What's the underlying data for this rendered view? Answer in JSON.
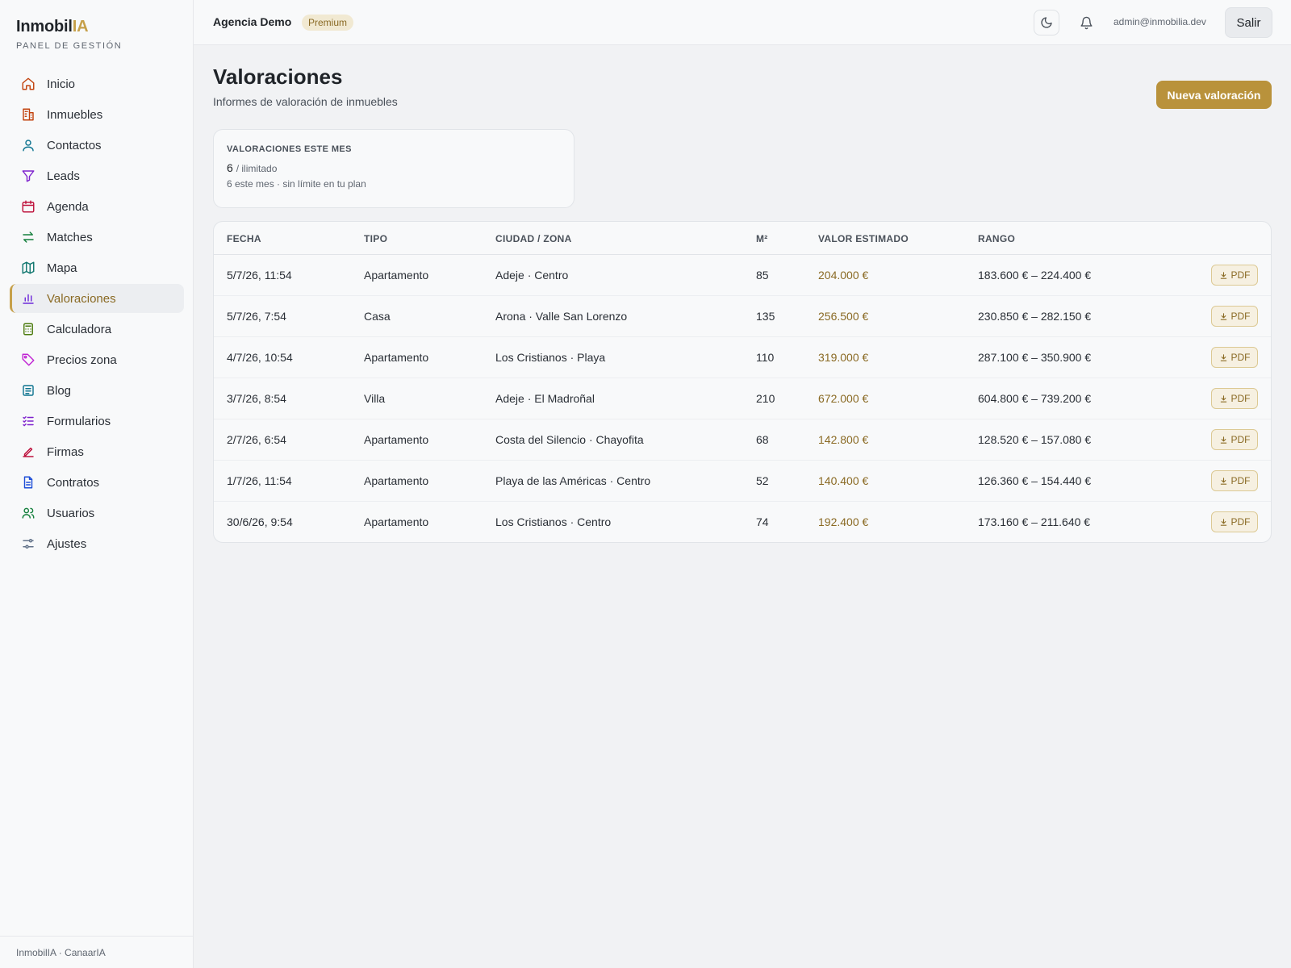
{
  "brand": {
    "name_main": "Inmobil",
    "name_accent": "IA",
    "subtitle": "PANEL DE GESTIÓN"
  },
  "sidebar": {
    "items": [
      {
        "label": "Inicio",
        "icon": "home-icon",
        "color": "#c2410c"
      },
      {
        "label": "Inmuebles",
        "icon": "building-icon",
        "color": "#c2410c"
      },
      {
        "label": "Contactos",
        "icon": "user-icon",
        "color": "#0e7490"
      },
      {
        "label": "Leads",
        "icon": "filter-icon",
        "color": "#7e22ce"
      },
      {
        "label": "Agenda",
        "icon": "calendar-icon",
        "color": "#be123c"
      },
      {
        "label": "Matches",
        "icon": "arrows-icon",
        "color": "#15803d"
      },
      {
        "label": "Mapa",
        "icon": "map-icon",
        "color": "#0f766e"
      },
      {
        "label": "Valoraciones",
        "icon": "bar-chart-icon",
        "color": "#6d28d9",
        "active": true
      },
      {
        "label": "Calculadora",
        "icon": "calculator-icon",
        "color": "#4d7c0f"
      },
      {
        "label": "Precios zona",
        "icon": "tag-icon",
        "color": "#c026d3"
      },
      {
        "label": "Blog",
        "icon": "newspaper-icon",
        "color": "#0e7490"
      },
      {
        "label": "Formularios",
        "icon": "list-check-icon",
        "color": "#7e22ce"
      },
      {
        "label": "Firmas",
        "icon": "signature-icon",
        "color": "#be123c"
      },
      {
        "label": "Contratos",
        "icon": "document-icon",
        "color": "#1d4ed8"
      },
      {
        "label": "Usuarios",
        "icon": "users-icon",
        "color": "#15803d"
      },
      {
        "label": "Ajustes",
        "icon": "sliders-icon",
        "color": "#64748b"
      }
    ],
    "footer": "InmobilIA · CanaarIA"
  },
  "topbar": {
    "agency": "Agencia Demo",
    "plan_badge": "Premium",
    "theme_icon": "moon-icon",
    "notifications_icon": "bell-icon",
    "user_email": "admin@inmobilia.dev",
    "logout_label": "Salir"
  },
  "page": {
    "title": "Valoraciones",
    "subtitle": "Informes de valoración de inmuebles",
    "new_button": "Nueva valoración"
  },
  "stat": {
    "label": "VALORACIONES ESTE MES",
    "value": "6",
    "limit": "/ ilimitado",
    "note": "6 este mes · sin límite en tu plan"
  },
  "table": {
    "headers": [
      "FECHA",
      "TIPO",
      "CIUDAD / ZONA",
      "M²",
      "VALOR ESTIMADO",
      "RANGO"
    ],
    "pdf_label": "PDF",
    "rows": [
      {
        "fecha": "5/7/26, 11:54",
        "tipo": "Apartamento",
        "zona": "Adeje · Centro",
        "m2": "85",
        "valor": "204.000 €",
        "rango": "183.600 € – 224.400 €"
      },
      {
        "fecha": "5/7/26, 7:54",
        "tipo": "Casa",
        "zona": "Arona · Valle San Lorenzo",
        "m2": "135",
        "valor": "256.500 €",
        "rango": "230.850 € – 282.150 €"
      },
      {
        "fecha": "4/7/26, 10:54",
        "tipo": "Apartamento",
        "zona": "Los Cristianos · Playa",
        "m2": "110",
        "valor": "319.000 €",
        "rango": "287.100 € – 350.900 €"
      },
      {
        "fecha": "3/7/26, 8:54",
        "tipo": "Villa",
        "zona": "Adeje · El Madroñal",
        "m2": "210",
        "valor": "672.000 €",
        "rango": "604.800 € – 739.200 €"
      },
      {
        "fecha": "2/7/26, 6:54",
        "tipo": "Apartamento",
        "zona": "Costa del Silencio · Chayofita",
        "m2": "68",
        "valor": "142.800 €",
        "rango": "128.520 € – 157.080 €"
      },
      {
        "fecha": "1/7/26, 11:54",
        "tipo": "Apartamento",
        "zona": "Playa de las Américas · Centro",
        "m2": "52",
        "valor": "140.400 €",
        "rango": "126.360 € – 154.440 €"
      },
      {
        "fecha": "30/6/26, 9:54",
        "tipo": "Apartamento",
        "zona": "Los Cristianos · Centro",
        "m2": "74",
        "valor": "192.400 €",
        "rango": "173.160 € – 211.640 €"
      }
    ]
  },
  "colors": {
    "accent": "#b9923b",
    "accent_text": "#8a6a24"
  }
}
